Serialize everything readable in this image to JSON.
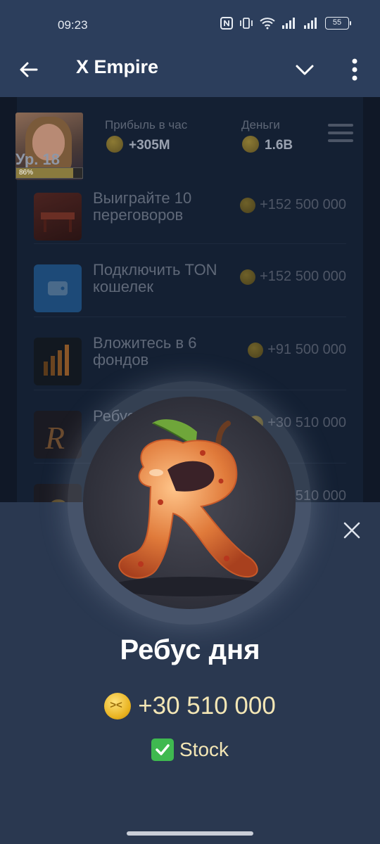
{
  "status_bar": {
    "time": "09:23",
    "battery": "55",
    "icons": [
      "nfc-icon",
      "vibrate-icon",
      "wifi-icon",
      "signal-icon",
      "signal-icon",
      "battery-icon"
    ]
  },
  "app_bar": {
    "title": "X Empire",
    "back_icon": "arrow-left-icon",
    "menu_icons": [
      "chevron-down-icon",
      "more-vertical-icon"
    ]
  },
  "header": {
    "level": "Ур. 18",
    "level_progress_text": "86%",
    "level_progress": 0.86,
    "profit_label": "Прибыль в час",
    "profit_value": "+305M",
    "money_label": "Деньги",
    "money_value": "1.6B"
  },
  "tasks": [
    {
      "title": "Выиграйте 10 переговоров",
      "reward": "+152 500 000"
    },
    {
      "title": "Подключить TON кошелек",
      "reward": "+152 500 000"
    },
    {
      "title": "Вложитесь в 6 фондов",
      "reward": "+91 500 000"
    },
    {
      "title": "Ребус дня",
      "reward": "+30 510 000"
    },
    {
      "title": "",
      "reward": "510 000"
    }
  ],
  "sheet": {
    "title": "Ребус дня",
    "reward": "+30 510 000",
    "answer_check": "✅",
    "answer": "Stock",
    "close_icon": "close-icon",
    "hero_icon": "cherry-letter-r-icon"
  },
  "colors": {
    "bar_bg": "#2c3e5c",
    "sheet_bg": "#2a3850",
    "overlay_bg": "#101827",
    "coin_gold": "#e8b21f",
    "reward_text": "#f3e6b5",
    "check_green": "#3fb950"
  }
}
